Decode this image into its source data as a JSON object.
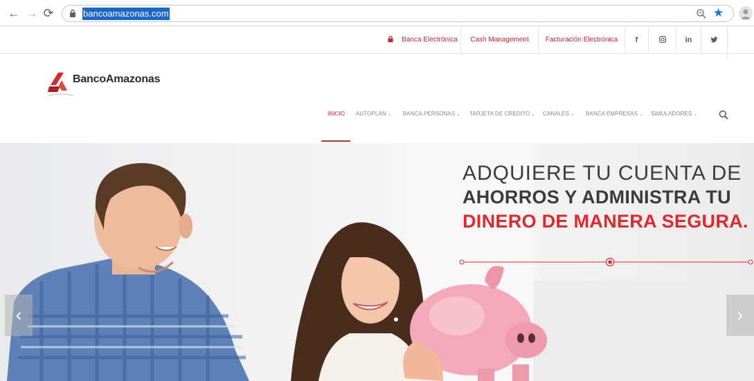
{
  "browser": {
    "url": "bancoamazonas.com",
    "back_icon": "arrow-left-icon",
    "forward_icon": "arrow-right-icon",
    "reload_icon": "reload-icon"
  },
  "utility_bar": {
    "items": [
      {
        "label": "Banca Electrónica",
        "icon": "lock-icon"
      },
      {
        "label": "Cash Management"
      },
      {
        "label": "Facturación Electrónica"
      }
    ],
    "social": [
      {
        "label": "f",
        "icon": "facebook-icon"
      },
      {
        "label": "◙",
        "icon": "instagram-icon"
      },
      {
        "label": "in",
        "icon": "linkedin-icon"
      },
      {
        "label": "🐦",
        "icon": "twitter-icon"
      }
    ]
  },
  "header": {
    "logo_text": "BancoAmazonas"
  },
  "nav": {
    "items": [
      {
        "label": "INICIO",
        "active": true,
        "dropdown": false
      },
      {
        "label": "AUTOPLAN",
        "dropdown": true
      },
      {
        "label": "BANCA PERSONAS",
        "dropdown": true
      },
      {
        "label": "TARJETA DE CREDITO",
        "dropdown": true
      },
      {
        "label": "CANALES",
        "dropdown": true
      },
      {
        "label": "BANCA EMPRESAS",
        "dropdown": true
      },
      {
        "label": "SIMULADORES",
        "dropdown": true
      }
    ],
    "caret": "⌄"
  },
  "hero": {
    "line1": "ADQUIERE TU CUENTA DE",
    "line2": "AHORROS Y ADMINISTRA TU",
    "line3": "DINERO DE MANERA SEGURA.",
    "prev_arrow": "‹",
    "next_arrow": "›"
  },
  "colors": {
    "brand_red": "#d22d2d",
    "accent_blue": "#1967d2"
  }
}
